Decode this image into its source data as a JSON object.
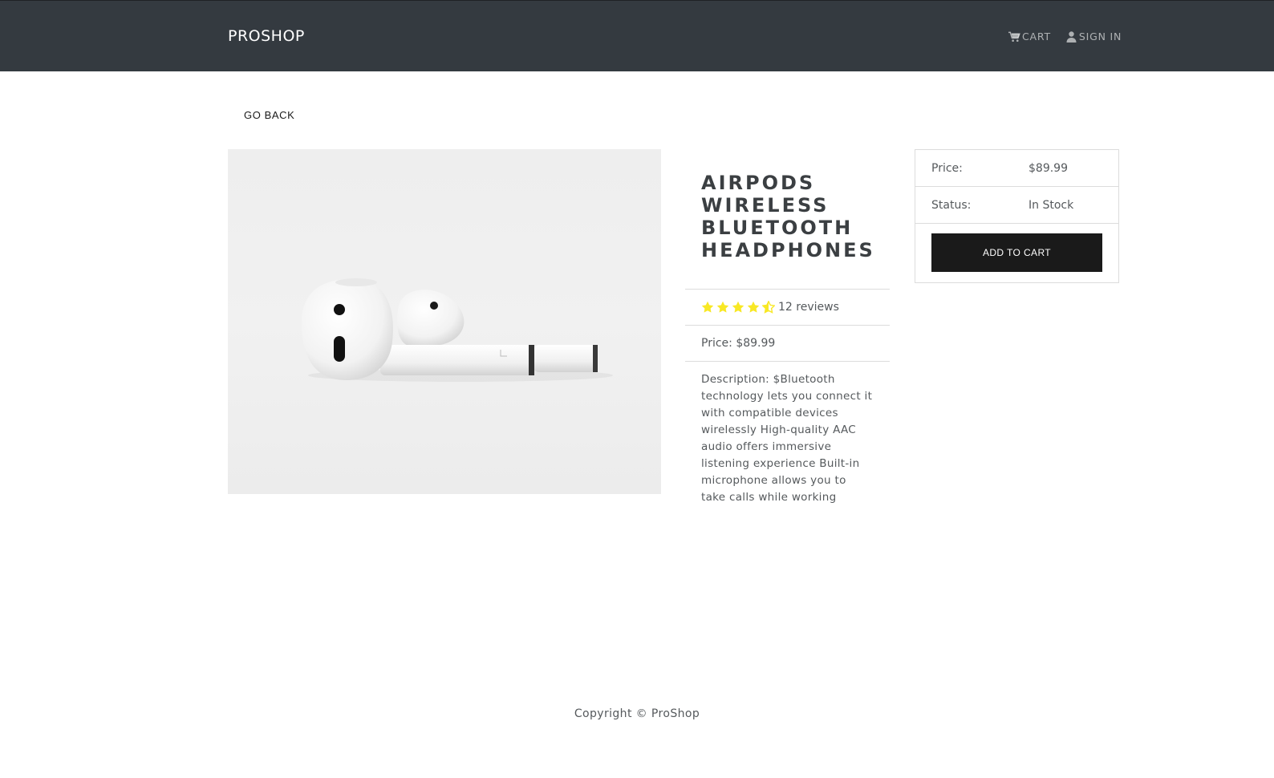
{
  "header": {
    "brand": "PROSHOP",
    "cart_label": "CART",
    "signin_label": "SIGN IN"
  },
  "go_back_label": "GO BACK",
  "product": {
    "image_alt": "Airpods Wireless Bluetooth Headphones",
    "title": "AIRPODS WIRELESS BLUETOOTH HEADPHONES",
    "rating": 4.5,
    "reviews_text": "12 reviews",
    "price_text": "Price: $89.99",
    "description_text": "Description: $Bluetooth technology lets you connect it with compatible devices wirelessly High-quality AAC audio offers immersive listening experience Built-in microphone allows you to take calls while working"
  },
  "purchase_card": {
    "price_label": "Price:",
    "price_value": "$89.99",
    "status_label": "Status:",
    "status_value": "In Stock",
    "button_label": "ADD TO CART"
  },
  "footer": {
    "copyright": "Copyright © ProShop"
  },
  "colors": {
    "navbar_bg": "#343a40",
    "star": "#f8e825",
    "button_bg": "#1a1a1a"
  },
  "icons": {
    "cart": "shopping-cart-icon",
    "user": "user-icon",
    "star": "star-icon"
  }
}
